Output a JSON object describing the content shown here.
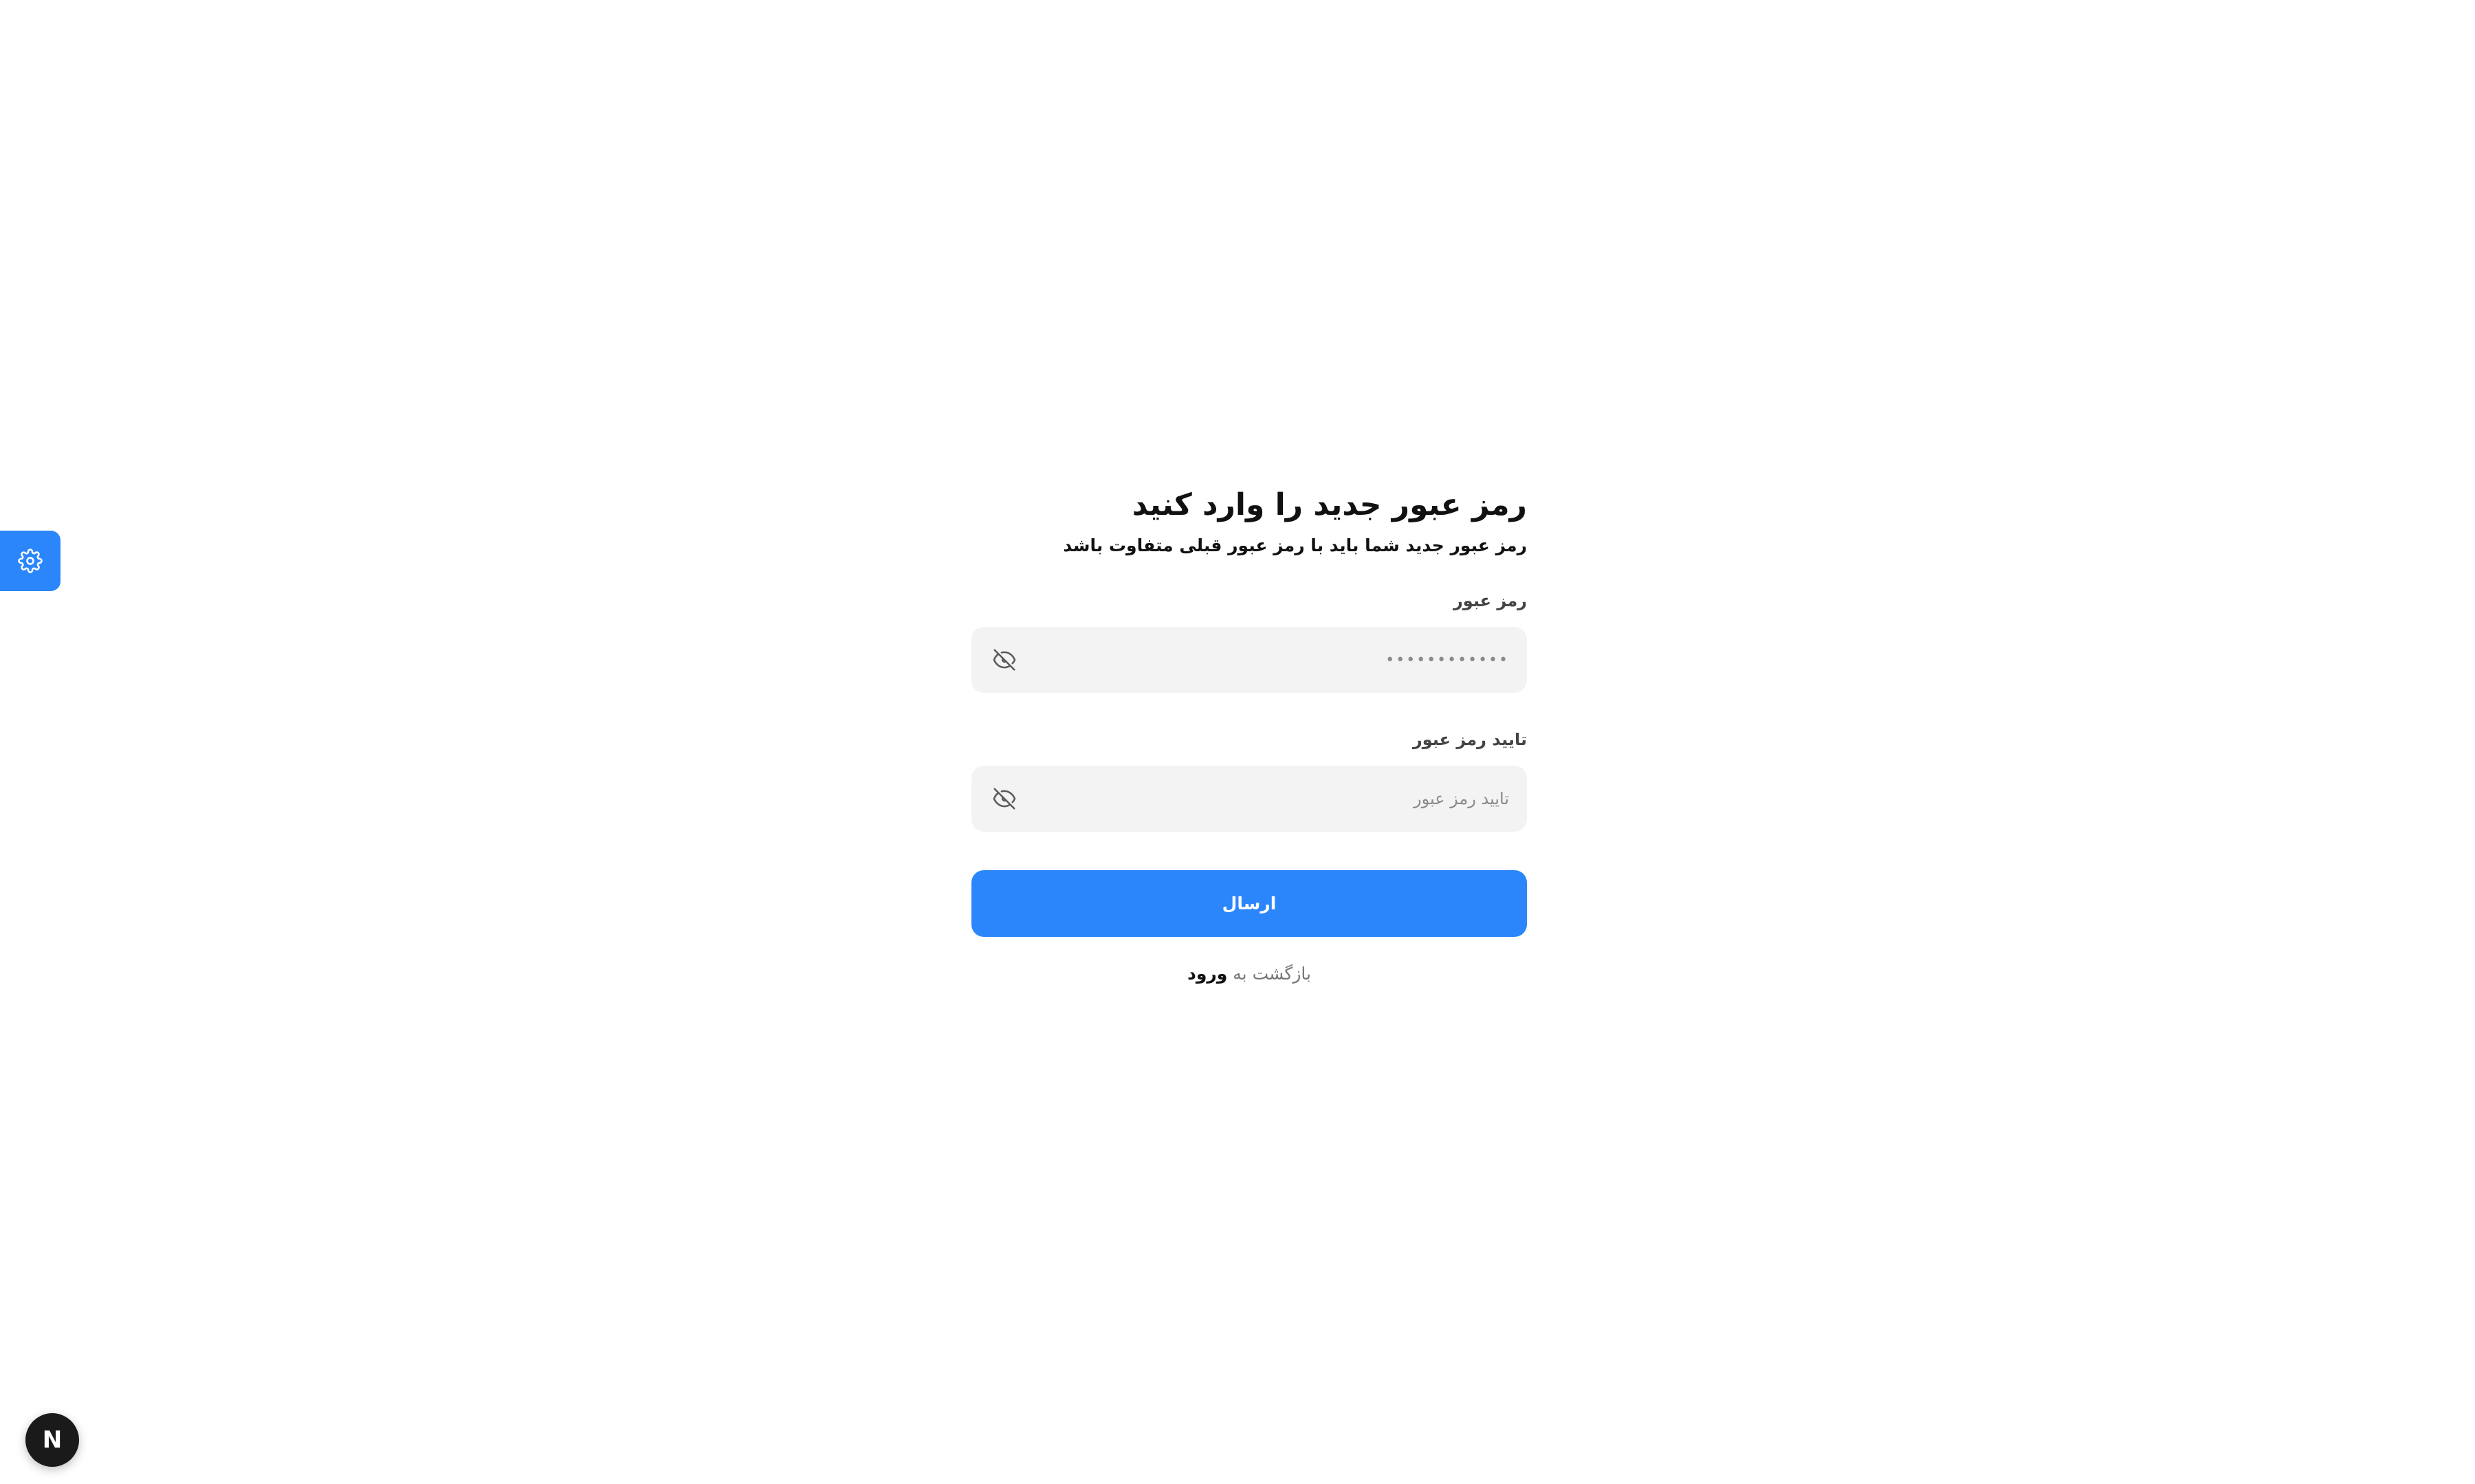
{
  "header": {
    "title": "رمز عبور جدید را وارد کنید",
    "subtitle": "رمز عبور جدید شما باید با رمز عبور قبلی متفاوت باشد"
  },
  "form": {
    "password": {
      "label": "رمز عبور",
      "value": "••••••••••••",
      "toggle_icon": "eye-off-icon"
    },
    "confirm_password": {
      "label": "تایید رمز عبور",
      "placeholder": "تایید رمز عبور",
      "value": "",
      "toggle_icon": "eye-off-icon"
    },
    "submit_label": "ارسال"
  },
  "footer": {
    "back_prefix": "بازگشت به",
    "back_link": "ورود"
  },
  "widgets": {
    "settings_icon": "gear-icon",
    "dev_badge_letter": "N"
  },
  "colors": {
    "accent": "#2b86fb",
    "input_bg": "#f3f3f3",
    "text": "#111111",
    "muted": "#777777"
  }
}
